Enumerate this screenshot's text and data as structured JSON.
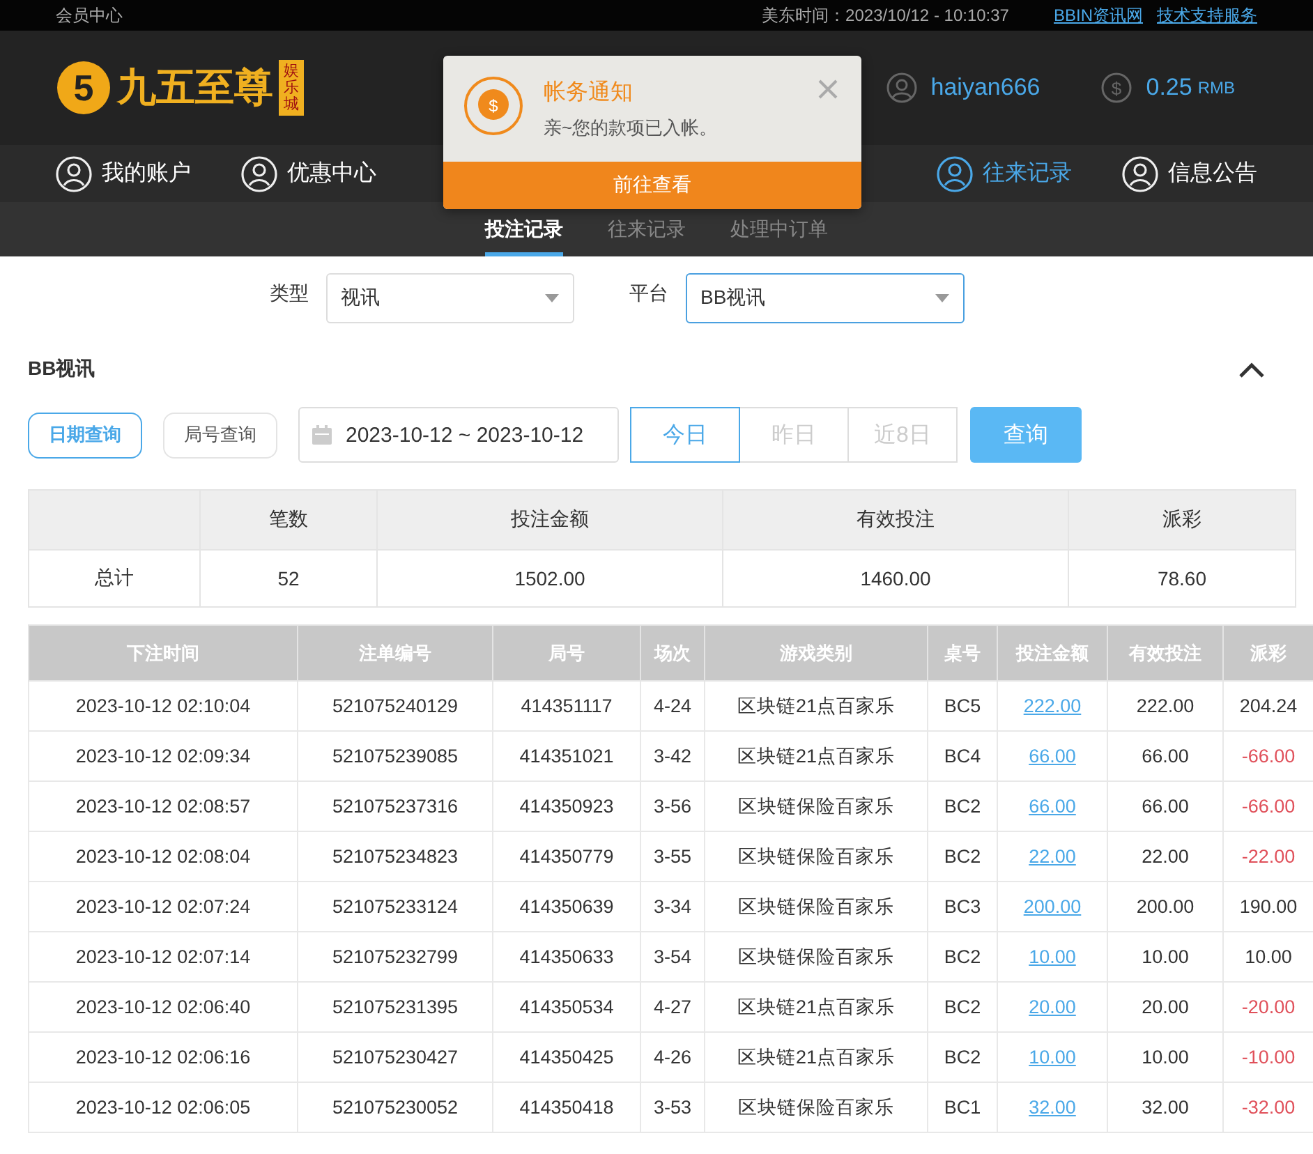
{
  "top_bar": {
    "left": "会员中心",
    "time": "美东时间：2023/10/12 - 10:10:37",
    "links": [
      "BBIN资讯网",
      "技术支持服务"
    ]
  },
  "header": {
    "logo_mark": "5",
    "currency_symbol": "$",
    "logo_text": "九五至尊",
    "logo_tag": "娱乐城",
    "username": "haiyan666",
    "balance": "0.25",
    "currency": "RMB"
  },
  "nav": [
    {
      "label": "我的账户",
      "selected": false
    },
    {
      "label": "优惠中心",
      "selected": false
    },
    {
      "label": "往来记录",
      "selected": true
    },
    {
      "label": "信息公告",
      "selected": false
    }
  ],
  "sub_tabs": [
    {
      "label": "投注记录",
      "selected": true
    },
    {
      "label": "往来记录",
      "selected": false
    },
    {
      "label": "处理中订单",
      "selected": false
    }
  ],
  "notification": {
    "icon_symbol": "$",
    "title": "帐务通知",
    "message": "亲~您的款项已入帐。",
    "action": "前往查看"
  },
  "filters": [
    {
      "label": "类型",
      "value": "视讯",
      "focused": false
    },
    {
      "label": "平台",
      "value": "BB视讯",
      "focused": true
    }
  ],
  "section_title": "BB视讯",
  "query_modes": [
    {
      "label": "日期查询",
      "selected": true
    },
    {
      "label": "局号查询",
      "selected": false
    }
  ],
  "date_range": "2023-10-12 ~ 2023-10-12",
  "quick_ranges": [
    {
      "label": "今日",
      "selected": true
    },
    {
      "label": "昨日",
      "selected": false
    },
    {
      "label": "近8日",
      "selected": false
    }
  ],
  "search_button": "查询",
  "summary": {
    "columns": [
      "",
      "笔数",
      "投注金额",
      "有效投注",
      "派彩"
    ],
    "row": [
      "总计",
      "52",
      "1502.00",
      "1460.00",
      "78.60"
    ]
  },
  "table": {
    "columns": [
      "下注时间",
      "注单编号",
      "局号",
      "场次",
      "游戏类别",
      "桌号",
      "投注金额",
      "有效投注",
      "派彩"
    ],
    "rows": [
      {
        "time": "2023-10-12 02:10:04",
        "order": "521075240129",
        "round": "414351117",
        "session": "4-24",
        "game": "区块链21点百家乐",
        "table": "BC5",
        "bet": "222.00",
        "valid": "222.00",
        "payout": "204.24",
        "loss": false
      },
      {
        "time": "2023-10-12 02:09:34",
        "order": "521075239085",
        "round": "414351021",
        "session": "3-42",
        "game": "区块链21点百家乐",
        "table": "BC4",
        "bet": "66.00",
        "valid": "66.00",
        "payout": "-66.00",
        "loss": true
      },
      {
        "time": "2023-10-12 02:08:57",
        "order": "521075237316",
        "round": "414350923",
        "session": "3-56",
        "game": "区块链保险百家乐",
        "table": "BC2",
        "bet": "66.00",
        "valid": "66.00",
        "payout": "-66.00",
        "loss": true
      },
      {
        "time": "2023-10-12 02:08:04",
        "order": "521075234823",
        "round": "414350779",
        "session": "3-55",
        "game": "区块链保险百家乐",
        "table": "BC2",
        "bet": "22.00",
        "valid": "22.00",
        "payout": "-22.00",
        "loss": true
      },
      {
        "time": "2023-10-12 02:07:24",
        "order": "521075233124",
        "round": "414350639",
        "session": "3-34",
        "game": "区块链保险百家乐",
        "table": "BC3",
        "bet": "200.00",
        "valid": "200.00",
        "payout": "190.00",
        "loss": false
      },
      {
        "time": "2023-10-12 02:07:14",
        "order": "521075232799",
        "round": "414350633",
        "session": "3-54",
        "game": "区块链保险百家乐",
        "table": "BC2",
        "bet": "10.00",
        "valid": "10.00",
        "payout": "10.00",
        "loss": false
      },
      {
        "time": "2023-10-12 02:06:40",
        "order": "521075231395",
        "round": "414350534",
        "session": "4-27",
        "game": "区块链21点百家乐",
        "table": "BC2",
        "bet": "20.00",
        "valid": "20.00",
        "payout": "-20.00",
        "loss": true
      },
      {
        "time": "2023-10-12 02:06:16",
        "order": "521075230427",
        "round": "414350425",
        "session": "4-26",
        "game": "区块链21点百家乐",
        "table": "BC2",
        "bet": "10.00",
        "valid": "10.00",
        "payout": "-10.00",
        "loss": true
      },
      {
        "time": "2023-10-12 02:06:05",
        "order": "521075230052",
        "round": "414350418",
        "session": "3-53",
        "game": "区块链保险百家乐",
        "table": "BC1",
        "bet": "32.00",
        "valid": "32.00",
        "payout": "-32.00",
        "loss": true
      }
    ]
  }
}
